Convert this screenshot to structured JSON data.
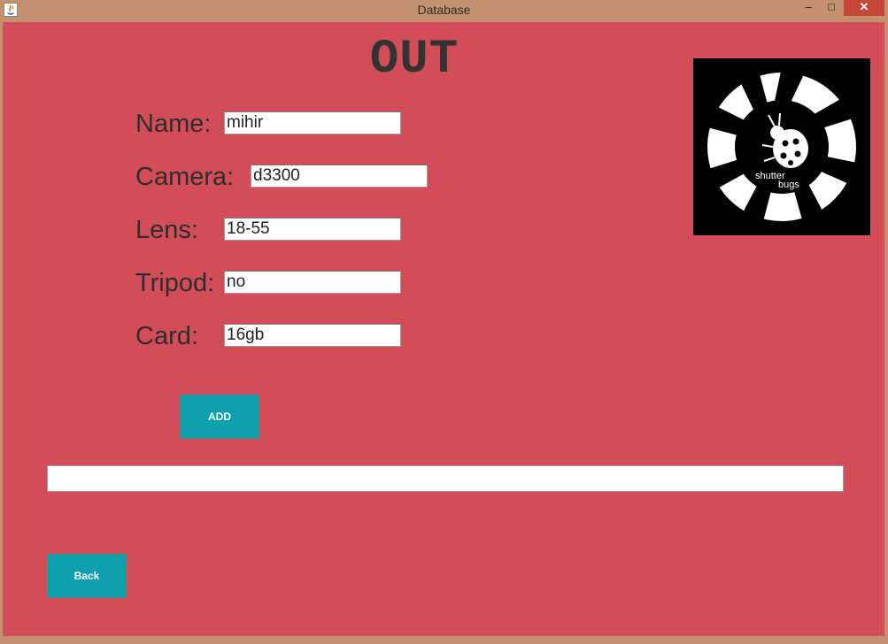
{
  "window": {
    "title": "Database",
    "minimize_glyph": "–",
    "maximize_glyph": "□",
    "close_glyph": "✕"
  },
  "form": {
    "heading": "OUT",
    "fields": {
      "name": {
        "label": "Name:",
        "value": "mihir"
      },
      "camera": {
        "label": "Camera:",
        "value": "d3300"
      },
      "lens": {
        "label": "Lens:",
        "value": "18-55"
      },
      "tripod": {
        "label": "Tripod:",
        "value": "no"
      },
      "card": {
        "label": "Card:",
        "value": "16gb"
      }
    },
    "add_label": "ADD",
    "result_value": "",
    "back_label": "Back"
  },
  "logo": {
    "line1": "shutter",
    "line2": "bugs"
  }
}
